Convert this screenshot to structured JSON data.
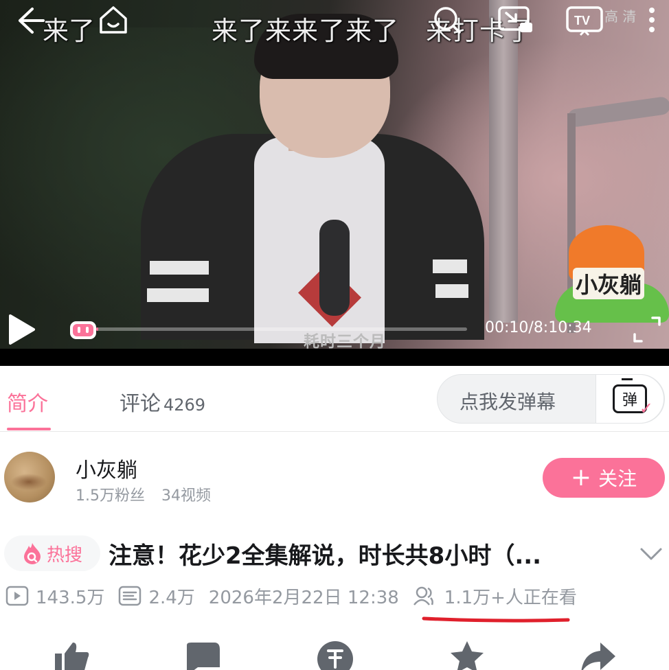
{
  "player": {
    "subtitle_top_left": "来了",
    "subtitle_top": "来了来来了来了　来打卡了",
    "quality_label": "高 清",
    "subtitle_bottom": "耗时三个月",
    "time_display": "00:10/8:10:34",
    "progress_fraction": 0.0003,
    "watermark": "小灰躺"
  },
  "tabs": {
    "intro_label": "简介",
    "comments_label": "评论",
    "comments_count": "4269"
  },
  "danmaku": {
    "placeholder": "点我发弹幕",
    "send_icon_text": "弹"
  },
  "uploader": {
    "name": "小灰躺",
    "fans": "1.5万粉丝",
    "videos": "34视频",
    "follow_label": "关注"
  },
  "video": {
    "hot_label": "热搜",
    "title": "注意！花少2全集解说，时长共8小时（...",
    "views": "143.5万",
    "danmaku_count": "2.4万",
    "date": "2026年2月22日 12:38",
    "watching": "1.1万+人正在看"
  },
  "colors": {
    "accent": "#fb7299",
    "annotation": "#e0202c"
  },
  "icons": [
    "back-icon",
    "home-icon",
    "search-icon",
    "mini-player-icon",
    "tv-icon",
    "more-icon",
    "play-icon",
    "danmaku-toggle-icon",
    "fullscreen-icon",
    "hot-search-icon",
    "view-icon",
    "danmaku-count-icon",
    "watching-icon",
    "chevron-down-icon",
    "like-icon",
    "dislike-icon",
    "coin-icon",
    "favorite-icon",
    "share-icon"
  ]
}
